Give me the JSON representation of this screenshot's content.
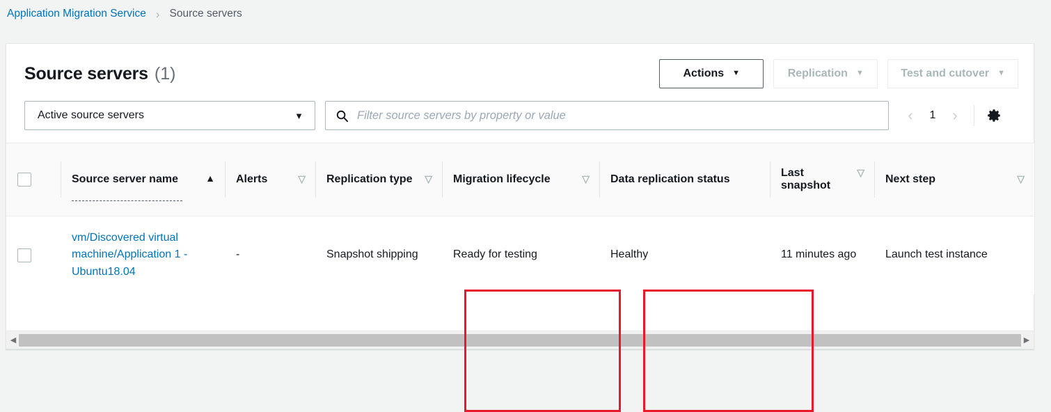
{
  "breadcrumb": {
    "service_link": "Application Migration Service",
    "separator": "›",
    "current": "Source servers"
  },
  "header": {
    "title": "Source servers",
    "count": "(1)",
    "buttons": [
      {
        "label": "Actions",
        "caret": "▼",
        "enabled": true
      },
      {
        "label": "Replication",
        "caret": "▼",
        "enabled": false
      },
      {
        "label": "Test and cutover",
        "caret": "▼",
        "enabled": false
      }
    ]
  },
  "filters": {
    "select_value": "Active source servers",
    "select_caret": "▼",
    "search_placeholder": "Filter source servers by property or value",
    "search_value": "",
    "search_icon": "search-icon",
    "pagination": {
      "prev": "‹",
      "page": "1",
      "next": "›"
    },
    "settings_icon": "gear-icon"
  },
  "table": {
    "columns": [
      {
        "key": "select",
        "label": "",
        "sort": "none",
        "bold": false
      },
      {
        "key": "name",
        "label": "Source server name",
        "sort": "asc",
        "arrow": "▲"
      },
      {
        "key": "alerts",
        "label": "Alerts",
        "sort": "idle",
        "arrow": "▽"
      },
      {
        "key": "reptype",
        "label": "Replication type",
        "sort": "idle",
        "arrow": "▽"
      },
      {
        "key": "lifecycle",
        "label": "Migration lifecycle",
        "sort": "idle",
        "arrow": "▽"
      },
      {
        "key": "drs",
        "label": "Data replication status",
        "sort": "none",
        "arrow": ""
      },
      {
        "key": "snapshot",
        "label": "Last snapshot",
        "sort": "idle",
        "arrow": "▽"
      },
      {
        "key": "next",
        "label": "Next step",
        "sort": "idle",
        "arrow": "▽"
      }
    ],
    "rows": [
      {
        "name": "vm/Discovered virtual machine/Application 1 - Ubuntu18.04",
        "alerts": "-",
        "reptype": "Snapshot shipping",
        "lifecycle": "Ready for testing",
        "drs": "Healthy",
        "snapshot": "11 minutes ago",
        "next": "Launch test instance"
      }
    ]
  },
  "annotations": [
    {
      "name": "migration-lifecycle-highlight",
      "color": "#e8192c"
    },
    {
      "name": "data-replication-status-highlight",
      "color": "#e8192c"
    }
  ],
  "scrollbar": {
    "left_arrow": "◀",
    "right_arrow": "▶"
  }
}
